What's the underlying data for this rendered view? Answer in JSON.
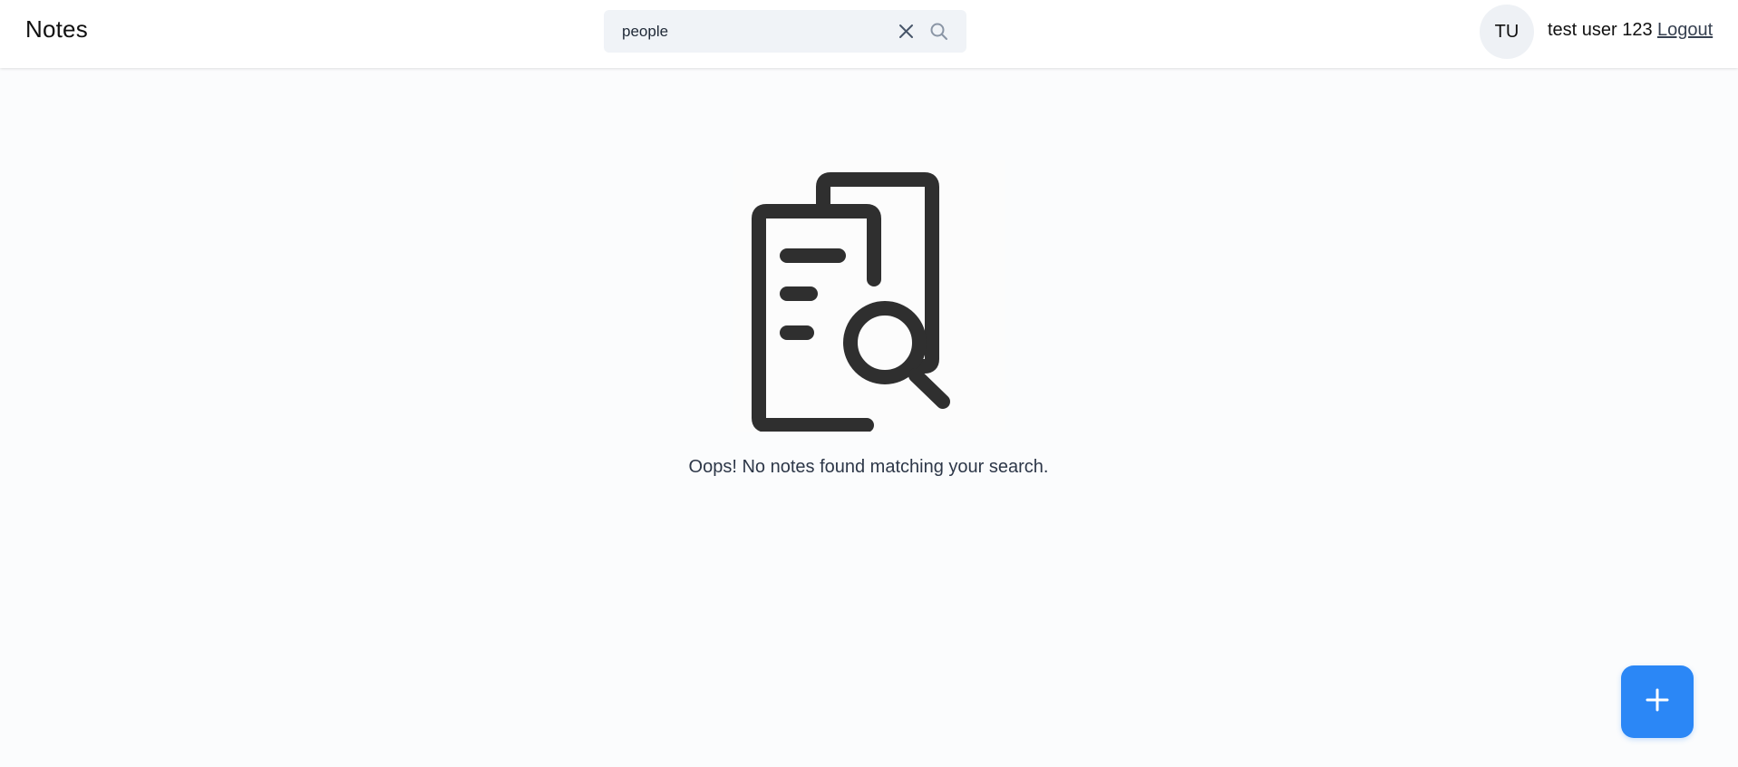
{
  "header": {
    "app_title": "Notes",
    "search": {
      "value": "people",
      "placeholder": "",
      "clear_icon": "close-icon",
      "search_icon": "search-icon"
    },
    "user": {
      "initials": "TU",
      "name": "test user 123",
      "logout_label": "Logout"
    }
  },
  "main": {
    "empty_state": {
      "illustration": "documents-search-icon",
      "message": "Oops! No notes found matching your search."
    }
  },
  "fab": {
    "icon": "plus-icon"
  },
  "colors": {
    "accent": "#2b87f6",
    "background": "#fbfcfd",
    "header_bg": "#ffffff",
    "search_bg": "#f0f3f7",
    "illustration_stroke": "#2f2f2f"
  }
}
